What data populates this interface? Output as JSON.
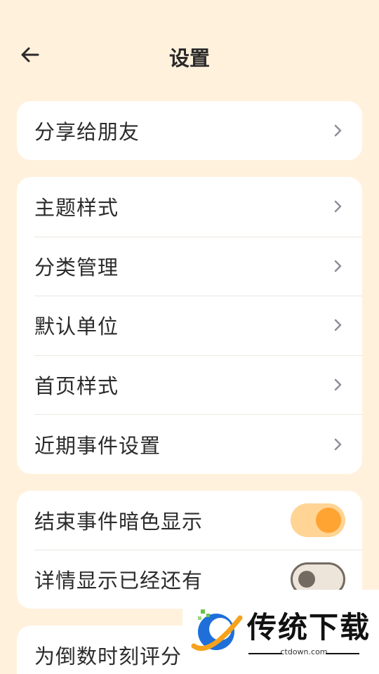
{
  "header": {
    "title": "设置"
  },
  "card_share": {
    "items": [
      {
        "label": "分享给朋友"
      }
    ]
  },
  "card_general": {
    "items": [
      {
        "label": "主题样式"
      },
      {
        "label": "分类管理"
      },
      {
        "label": "默认单位"
      },
      {
        "label": "首页样式"
      },
      {
        "label": "近期事件设置"
      }
    ]
  },
  "card_toggles": {
    "items": [
      {
        "label": "结束事件暗色显示",
        "on": true
      },
      {
        "label": "详情显示已经还有",
        "on": false
      }
    ]
  },
  "card_rate": {
    "items": [
      {
        "label": "为倒数时刻评分"
      }
    ]
  },
  "watermark": {
    "title": "传统下载",
    "subtitle": "ctdown.com"
  },
  "colors": {
    "background": "#FFF1DC",
    "card": "#FFFFFF",
    "accent": "#FFA332",
    "accent_light": "#FFD494"
  }
}
